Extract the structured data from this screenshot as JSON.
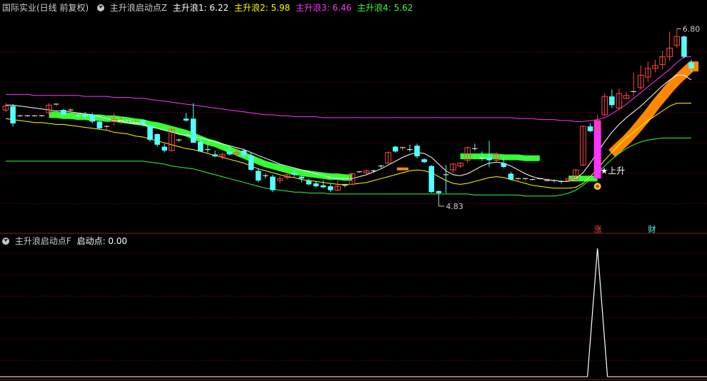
{
  "header": {
    "stock": "国际实业(日线 前复权)",
    "indicator": "主升浪启动点Z",
    "lines": [
      {
        "label": "主升浪1: 6.22",
        "color": "#ffffff"
      },
      {
        "label": "主升浪2: 5.98",
        "color": "#ffff00"
      },
      {
        "label": "主升浪3: 6.46",
        "color": "#ff33ff"
      },
      {
        "label": "主升浪4: 5.62",
        "color": "#33ff33"
      }
    ]
  },
  "sub_header": {
    "indicator": "主升浪启动点F",
    "label": "启动点: 0.00",
    "label_color": "#ffffff"
  },
  "colors": {
    "up": "#ff4444",
    "down": "#55ffff",
    "green_band": "#33ff33",
    "orange_band": "#ff8800",
    "magenta_bar": "#ff33ff",
    "grid": "#881111"
  },
  "chart_data": [
    {
      "type": "candlestick",
      "title": "",
      "price_range": [
        4.7,
        6.9
      ],
      "annotations": {
        "high_label": "6.80",
        "low_label": "4.83",
        "signal_text": "★上升",
        "marker_zhang": "涨",
        "marker_cai": "财"
      },
      "candles": [
        [
          5.91,
          5.98,
          5.89,
          5.95
        ],
        [
          5.95,
          5.97,
          5.74,
          5.77
        ],
        [
          5.85,
          5.86,
          5.84,
          5.85
        ],
        [
          5.85,
          5.86,
          5.84,
          5.85
        ],
        [
          5.85,
          5.86,
          5.84,
          5.85
        ],
        [
          5.85,
          5.86,
          5.84,
          5.85
        ],
        [
          5.88,
          5.98,
          5.86,
          5.96
        ],
        [
          5.96,
          5.98,
          5.95,
          5.97
        ],
        [
          5.91,
          5.92,
          5.85,
          5.86
        ],
        [
          5.9,
          5.93,
          5.88,
          5.91
        ],
        [
          5.85,
          5.87,
          5.83,
          5.84
        ],
        [
          5.86,
          5.89,
          5.82,
          5.84
        ],
        [
          5.86,
          5.88,
          5.77,
          5.79
        ],
        [
          5.79,
          5.8,
          5.71,
          5.72
        ],
        [
          5.73,
          5.75,
          5.7,
          5.74
        ],
        [
          5.79,
          5.88,
          5.75,
          5.81
        ],
        [
          5.79,
          5.84,
          5.76,
          5.8
        ],
        [
          5.79,
          5.81,
          5.78,
          5.8
        ],
        [
          5.78,
          5.8,
          5.77,
          5.78
        ],
        [
          5.8,
          5.81,
          5.74,
          5.76
        ],
        [
          5.75,
          5.76,
          5.58,
          5.6
        ],
        [
          5.66,
          5.67,
          5.53,
          5.55
        ],
        [
          5.53,
          5.56,
          5.47,
          5.49
        ],
        [
          5.49,
          5.72,
          5.48,
          5.71
        ],
        [
          5.6,
          5.61,
          5.58,
          5.59
        ],
        [
          5.82,
          5.88,
          5.79,
          5.8
        ],
        [
          5.82,
          5.98,
          5.58,
          5.57
        ],
        [
          5.58,
          5.62,
          5.48,
          5.48
        ],
        [
          5.5,
          5.57,
          5.47,
          5.49
        ],
        [
          5.45,
          5.49,
          5.42,
          5.43
        ],
        [
          5.43,
          5.47,
          5.4,
          5.45
        ],
        [
          5.48,
          5.54,
          5.44,
          5.45
        ],
        [
          5.45,
          5.52,
          5.44,
          5.47
        ],
        [
          5.49,
          5.51,
          5.42,
          5.44
        ],
        [
          5.44,
          5.47,
          5.28,
          5.29
        ],
        [
          5.28,
          5.31,
          5.16,
          5.18
        ],
        [
          5.23,
          5.25,
          5.2,
          5.22
        ],
        [
          5.22,
          5.24,
          5.06,
          5.08
        ],
        [
          5.18,
          5.22,
          5.15,
          5.2
        ],
        [
          5.21,
          5.25,
          5.19,
          5.24
        ],
        [
          5.26,
          5.29,
          5.22,
          5.24
        ],
        [
          5.22,
          5.23,
          5.16,
          5.2
        ],
        [
          5.18,
          5.2,
          5.13,
          5.14
        ],
        [
          5.15,
          5.17,
          5.11,
          5.12
        ],
        [
          5.13,
          5.18,
          5.1,
          5.11
        ],
        [
          5.12,
          5.15,
          5.06,
          5.08
        ],
        [
          5.08,
          5.19,
          5.07,
          5.12
        ],
        [
          5.13,
          5.14,
          5.11,
          5.12
        ],
        [
          5.14,
          5.26,
          5.13,
          5.25
        ],
        [
          5.27,
          5.28,
          5.26,
          5.27
        ],
        [
          5.26,
          5.29,
          5.25,
          5.28
        ],
        [
          5.28,
          5.29,
          5.26,
          5.27
        ],
        [
          5.33,
          5.34,
          5.31,
          5.32
        ],
        [
          5.36,
          5.48,
          5.35,
          5.47
        ],
        [
          5.53,
          5.54,
          5.47,
          5.48
        ],
        [
          5.51,
          5.53,
          5.49,
          5.52
        ],
        [
          5.5,
          5.55,
          5.48,
          5.49
        ],
        [
          5.54,
          5.56,
          5.41,
          5.43
        ],
        [
          5.4,
          5.41,
          5.36,
          5.37
        ],
        [
          5.33,
          5.34,
          5.05,
          5.06
        ],
        [
          5.07,
          5.08,
          5.04,
          5.05
        ],
        [
          5.24,
          5.34,
          5.05,
          5.23
        ],
        [
          5.29,
          5.36,
          5.26,
          5.35
        ],
        [
          5.33,
          5.37,
          5.31,
          5.36
        ],
        [
          5.39,
          5.53,
          5.36,
          5.52
        ],
        [
          5.51,
          5.56,
          5.49,
          5.5
        ],
        [
          5.41,
          5.48,
          5.38,
          5.4
        ],
        [
          5.42,
          5.59,
          5.32,
          5.39
        ],
        [
          5.39,
          5.47,
          5.37,
          5.45
        ],
        [
          5.36,
          5.41,
          5.31,
          5.32
        ],
        [
          5.25,
          5.27,
          5.18,
          5.19
        ],
        [
          5.2,
          5.21,
          5.18,
          5.2
        ],
        [
          5.2,
          5.21,
          5.18,
          5.2
        ],
        [
          5.19,
          5.2,
          5.18,
          5.19
        ],
        [
          5.2,
          5.21,
          5.19,
          5.2
        ],
        [
          5.18,
          5.2,
          5.17,
          5.18
        ],
        [
          5.18,
          5.19,
          5.16,
          5.17
        ],
        [
          5.17,
          5.18,
          5.15,
          5.16
        ],
        [
          5.18,
          5.21,
          5.17,
          5.2
        ],
        [
          5.19,
          5.3,
          5.18,
          5.29
        ],
        [
          5.34,
          5.75,
          5.33,
          5.74
        ],
        [
          5.74,
          5.77,
          5.68,
          5.69
        ],
        [
          5.71,
          5.86,
          5.7,
          5.8
        ],
        [
          5.86,
          6.08,
          5.85,
          6.05
        ],
        [
          6.05,
          6.12,
          5.93,
          5.96
        ],
        [
          5.93,
          6.13,
          5.91,
          6.08
        ],
        [
          6.03,
          6.1,
          6.02,
          6.06
        ],
        [
          6.09,
          6.3,
          6.05,
          6.1
        ],
        [
          6.14,
          6.37,
          6.12,
          6.27
        ],
        [
          6.25,
          6.41,
          6.2,
          6.34
        ],
        [
          6.34,
          6.43,
          6.3,
          6.37
        ],
        [
          6.38,
          6.52,
          6.33,
          6.46
        ],
        [
          6.46,
          6.72,
          6.42,
          6.55
        ],
        [
          6.58,
          6.75,
          6.55,
          6.67
        ],
        [
          6.67,
          6.68,
          6.44,
          6.46
        ],
        [
          6.4,
          6.43,
          6.3,
          6.34
        ]
      ],
      "series": [
        {
          "name": "主升浪1",
          "color": "#ffffff",
          "values": [
            5.96,
            5.96,
            5.95,
            5.94,
            5.93,
            5.92,
            5.91,
            5.9,
            5.9,
            5.89,
            5.88,
            5.87,
            5.86,
            5.84,
            5.82,
            5.8,
            5.79,
            5.78,
            5.77,
            5.76,
            5.74,
            5.72,
            5.7,
            5.68,
            5.66,
            5.65,
            5.64,
            5.62,
            5.6,
            5.58,
            5.56,
            5.54,
            5.52,
            5.5,
            5.47,
            5.44,
            5.41,
            5.38,
            5.35,
            5.33,
            5.31,
            5.29,
            5.27,
            5.25,
            5.23,
            5.21,
            5.2,
            5.2,
            5.2,
            5.22,
            5.24,
            5.27,
            5.3,
            5.34,
            5.38,
            5.42,
            5.45,
            5.47,
            5.46,
            5.42,
            5.35,
            5.28,
            5.24,
            5.23,
            5.25,
            5.29,
            5.33,
            5.36,
            5.37,
            5.36,
            5.33,
            5.29,
            5.25,
            5.22,
            5.2,
            5.19,
            5.18,
            5.17,
            5.17,
            5.2,
            5.26,
            5.36,
            5.47,
            5.58,
            5.68,
            5.76,
            5.83,
            5.89,
            5.95,
            6.02,
            6.09,
            6.16,
            6.22,
            6.27,
            6.27,
            6.22
          ]
        },
        {
          "name": "主升浪2",
          "color": "#ffff00",
          "values": [
            5.82,
            5.81,
            5.8,
            5.79,
            5.78,
            5.78,
            5.77,
            5.76,
            5.76,
            5.75,
            5.74,
            5.73,
            5.72,
            5.71,
            5.7,
            5.68,
            5.67,
            5.66,
            5.64,
            5.63,
            5.61,
            5.59,
            5.57,
            5.55,
            5.53,
            5.51,
            5.5,
            5.48,
            5.46,
            5.44,
            5.42,
            5.4,
            5.38,
            5.36,
            5.33,
            5.3,
            5.28,
            5.26,
            5.24,
            5.22,
            5.21,
            5.19,
            5.18,
            5.17,
            5.16,
            5.15,
            5.14,
            5.14,
            5.14,
            5.15,
            5.16,
            5.18,
            5.2,
            5.22,
            5.24,
            5.26,
            5.28,
            5.29,
            5.28,
            5.26,
            5.22,
            5.18,
            5.15,
            5.14,
            5.15,
            5.17,
            5.19,
            5.21,
            5.22,
            5.21,
            5.19,
            5.17,
            5.15,
            5.13,
            5.12,
            5.11,
            5.1,
            5.1,
            5.1,
            5.11,
            5.15,
            5.22,
            5.3,
            5.39,
            5.47,
            5.55,
            5.62,
            5.68,
            5.74,
            5.8,
            5.85,
            5.9,
            5.95,
            5.98,
            5.98,
            5.98
          ]
        },
        {
          "name": "主升浪3",
          "color": "#ff33ff",
          "values": [
            6.07,
            6.07,
            6.07,
            6.07,
            6.06,
            6.06,
            6.06,
            6.06,
            6.06,
            6.06,
            6.06,
            6.05,
            6.05,
            6.05,
            6.05,
            6.04,
            6.04,
            6.04,
            6.03,
            6.03,
            6.02,
            6.01,
            6.0,
            5.99,
            5.98,
            5.97,
            5.96,
            5.95,
            5.94,
            5.93,
            5.92,
            5.91,
            5.9,
            5.89,
            5.88,
            5.87,
            5.86,
            5.86,
            5.85,
            5.85,
            5.84,
            5.84,
            5.84,
            5.84,
            5.83,
            5.83,
            5.83,
            5.83,
            5.83,
            5.83,
            5.83,
            5.83,
            5.83,
            5.83,
            5.83,
            5.83,
            5.83,
            5.83,
            5.83,
            5.83,
            5.83,
            5.83,
            5.83,
            5.83,
            5.83,
            5.83,
            5.83,
            5.83,
            5.83,
            5.83,
            5.83,
            5.82,
            5.82,
            5.82,
            5.81,
            5.81,
            5.81,
            5.8,
            5.8,
            5.79,
            5.79,
            5.8,
            5.81,
            5.83,
            5.87,
            5.92,
            5.97,
            6.03,
            6.09,
            6.15,
            6.21,
            6.27,
            6.33,
            6.4,
            6.46,
            6.46
          ]
        },
        {
          "name": "主升浪4",
          "color": "#33ff33",
          "values": [
            5.38,
            5.38,
            5.38,
            5.38,
            5.38,
            5.38,
            5.38,
            5.38,
            5.38,
            5.38,
            5.38,
            5.38,
            5.38,
            5.38,
            5.38,
            5.38,
            5.38,
            5.38,
            5.38,
            5.38,
            5.37,
            5.36,
            5.35,
            5.33,
            5.32,
            5.31,
            5.3,
            5.28,
            5.26,
            5.24,
            5.22,
            5.2,
            5.18,
            5.16,
            5.14,
            5.12,
            5.1,
            5.09,
            5.08,
            5.07,
            5.06,
            5.06,
            5.05,
            5.05,
            5.05,
            5.04,
            5.04,
            5.04,
            5.04,
            5.04,
            5.04,
            5.04,
            5.04,
            5.04,
            5.04,
            5.04,
            5.04,
            5.04,
            5.04,
            5.04,
            5.04,
            5.04,
            5.04,
            5.04,
            5.04,
            5.03,
            5.03,
            5.03,
            5.03,
            5.03,
            5.03,
            5.03,
            5.02,
            5.02,
            5.02,
            5.02,
            5.02,
            5.03,
            5.05,
            5.08,
            5.13,
            5.19,
            5.26,
            5.33,
            5.4,
            5.46,
            5.51,
            5.55,
            5.58,
            5.6,
            5.61,
            5.62,
            5.62,
            5.62,
            5.62,
            5.62
          ]
        }
      ],
      "green_band": {
        "from": 6,
        "to": 48,
        "values": [
          5.86,
          5.86,
          5.85,
          5.85,
          5.84,
          5.84,
          5.83,
          5.83,
          5.82,
          5.82,
          5.81,
          5.8,
          5.79,
          5.78,
          5.76,
          5.75,
          5.73,
          5.71,
          5.69,
          5.67,
          5.64,
          5.61,
          5.58,
          5.56,
          5.53,
          5.5,
          5.47,
          5.44,
          5.41,
          5.38,
          5.35,
          5.33,
          5.31,
          5.29,
          5.27,
          5.26,
          5.25,
          5.24,
          5.23,
          5.22,
          5.22,
          5.21,
          5.21
        ]
      },
      "green_band2": {
        "from": 63,
        "to": 74,
        "values": [
          5.43,
          5.43,
          5.43,
          5.43,
          5.43,
          5.43,
          5.42,
          5.42,
          5.42,
          5.41,
          5.41,
          5.41
        ]
      },
      "green_band3": {
        "from": 78,
        "to": 82,
        "values": [
          5.2,
          5.2,
          5.2,
          5.2,
          5.2
        ]
      },
      "orange_band": {
        "from": 84,
        "to": 96,
        "values": [
          5.46,
          5.53,
          5.6,
          5.68,
          5.77,
          5.86,
          5.96,
          6.05,
          6.14,
          6.22,
          6.29,
          6.36,
          6.36
        ]
      },
      "magenta_bar": {
        "index": 82,
        "low": 5.2,
        "high": 5.8
      }
    },
    {
      "type": "line",
      "title": "",
      "ylim": [
        0,
        1
      ],
      "values_desc": "启动点 spike",
      "spike_index": 82,
      "spike_value": 1
    }
  ]
}
